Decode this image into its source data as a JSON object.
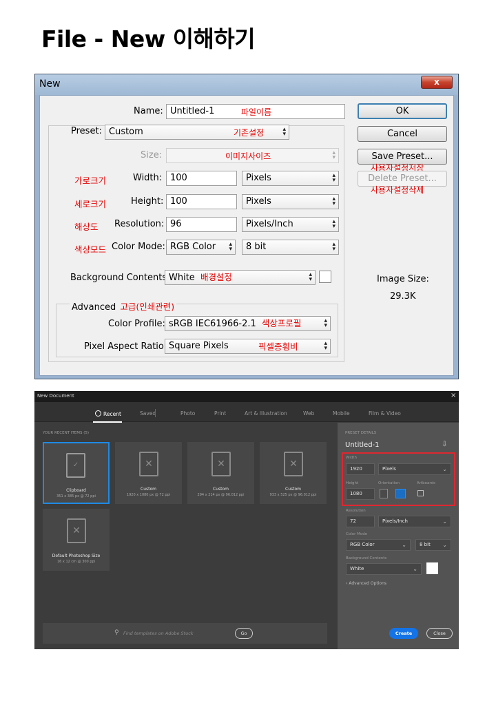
{
  "page_title": "File - New 이해하기",
  "classic": {
    "title": "New",
    "close_glyph": "x",
    "name_label": "Name:",
    "name_value": "Untitled-1",
    "name_note": "파일이름",
    "preset_label": "Preset:",
    "preset_value": "Custom",
    "preset_note": "기존설정",
    "size_label": "Size:",
    "size_note": "이미지사이즈",
    "width_note": "가로크기",
    "width_label": "Width:",
    "width_value": "100",
    "width_unit": "Pixels",
    "height_note": "세로크기",
    "height_label": "Height:",
    "height_value": "100",
    "height_unit": "Pixels",
    "resolution_note": "해상도",
    "resolution_label": "Resolution:",
    "resolution_value": "96",
    "resolution_unit": "Pixels/Inch",
    "colormode_note": "색상모드",
    "colormode_label": "Color Mode:",
    "colormode_value": "RGB Color",
    "bitdepth_value": "8 bit",
    "bg_label": "Background Contents:",
    "bg_value": "White",
    "bg_note": "배경설정",
    "advanced_label": "Advanced",
    "advanced_note": "고급(인쇄관련)",
    "profile_label": "Color Profile:",
    "profile_value": "sRGB IEC61966-2.1",
    "profile_note": "색상프로필",
    "aspect_label": "Pixel Aspect Ratio:",
    "aspect_value": "Square Pixels",
    "aspect_note": "픽셀종횡비",
    "ok_label": "OK",
    "cancel_label": "Cancel",
    "save_preset_label": "Save Preset...",
    "save_preset_note": "사용자설정저장",
    "delete_preset_label": "Delete Preset...",
    "delete_preset_note": "사용자설정삭제",
    "image_size_label": "Image Size:",
    "image_size_value": "29.3K"
  },
  "modern": {
    "title": "New Document",
    "close_glyph": "×",
    "tabs": [
      "Recent",
      "Saved",
      "Photo",
      "Print",
      "Art & Illustration",
      "Web",
      "Mobile",
      "Film & Video"
    ],
    "recent_header": "YOUR RECENT ITEMS  (5)",
    "items": [
      {
        "name": "Clipboard",
        "size": "351 x 385 px @ 72 ppi"
      },
      {
        "name": "Custom",
        "size": "1920 x 1080 px @ 72 ppi"
      },
      {
        "name": "Custom",
        "size": "294 x 214 px @ 96.012 ppi"
      },
      {
        "name": "Custom",
        "size": "933 x 525 px @ 96.012 ppi"
      },
      {
        "name": "Default Photoshop Size",
        "size": "16 x 12 cm @ 300 ppi"
      }
    ],
    "search_placeholder": "Find templates on Adobe Stock",
    "go_label": "Go",
    "preset_details_label": "PRESET DETAILS",
    "doc_name": "Untitled-1",
    "width_label": "Width",
    "width_value": "1920",
    "width_unit": "Pixels",
    "height_label": "Height",
    "height_value": "1080",
    "orientation_label": "Orientation",
    "artboards_label": "Artboards",
    "resolution_label": "Resolution",
    "resolution_value": "72",
    "resolution_unit": "Pixels/Inch",
    "colormode_label": "Color Mode",
    "colormode_value": "RGB Color",
    "bitdepth_value": "8 bit",
    "bg_label": "Background Contents",
    "bg_value": "White",
    "advanced_label": "Advanced Options",
    "create_label": "Create",
    "close_label": "Close",
    "colors": {
      "accent": "#1473e6",
      "highlight": "#e0262f",
      "selected_border": "#1e8ae6"
    }
  }
}
